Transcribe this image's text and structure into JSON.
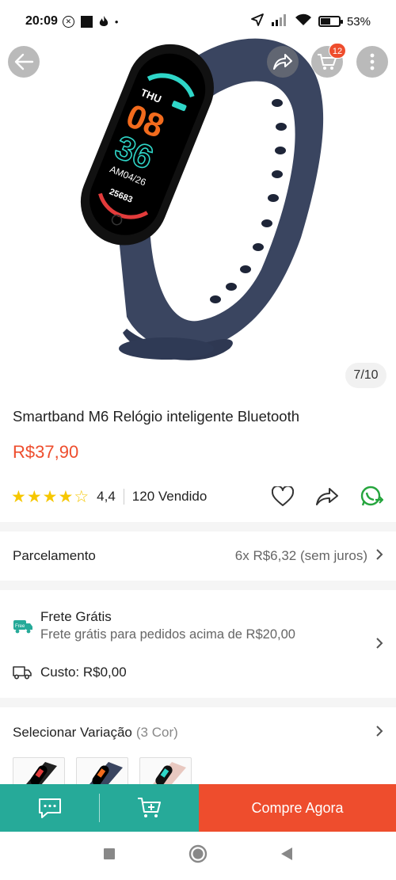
{
  "status_bar": {
    "time": "20:09",
    "battery": "53%",
    "battery_level": 0.53
  },
  "header": {
    "cart_count": "12",
    "image_counter": "7/10"
  },
  "product": {
    "title": "Smartband M6 Relógio inteligente Bluetooth",
    "price": "R$37,90",
    "rating_value": "4,4",
    "rating_stars": 4.4,
    "sold": "120 Vendido"
  },
  "installments": {
    "label": "Parcelamento",
    "value": "6x R$6,32 (sem juros)"
  },
  "shipping": {
    "free_badge": "Free",
    "title": "Frete Grátis",
    "subtitle": "Frete grátis para pedidos acima de R$20,00",
    "cost": "Custo: R$0,00"
  },
  "variation": {
    "label": "Selecionar Variação",
    "count": "(3 Cor)"
  },
  "bottom_bar": {
    "buy_now": "Compre Agora"
  },
  "watch_screen": {
    "day": "THU",
    "hour": "08",
    "minute": "36",
    "date": "AM04/26",
    "steps": "25683"
  },
  "colors": {
    "accent": "#ee4d2d",
    "teal": "#26aa99",
    "star": "#f6c700",
    "whatsapp": "#25a53d"
  }
}
